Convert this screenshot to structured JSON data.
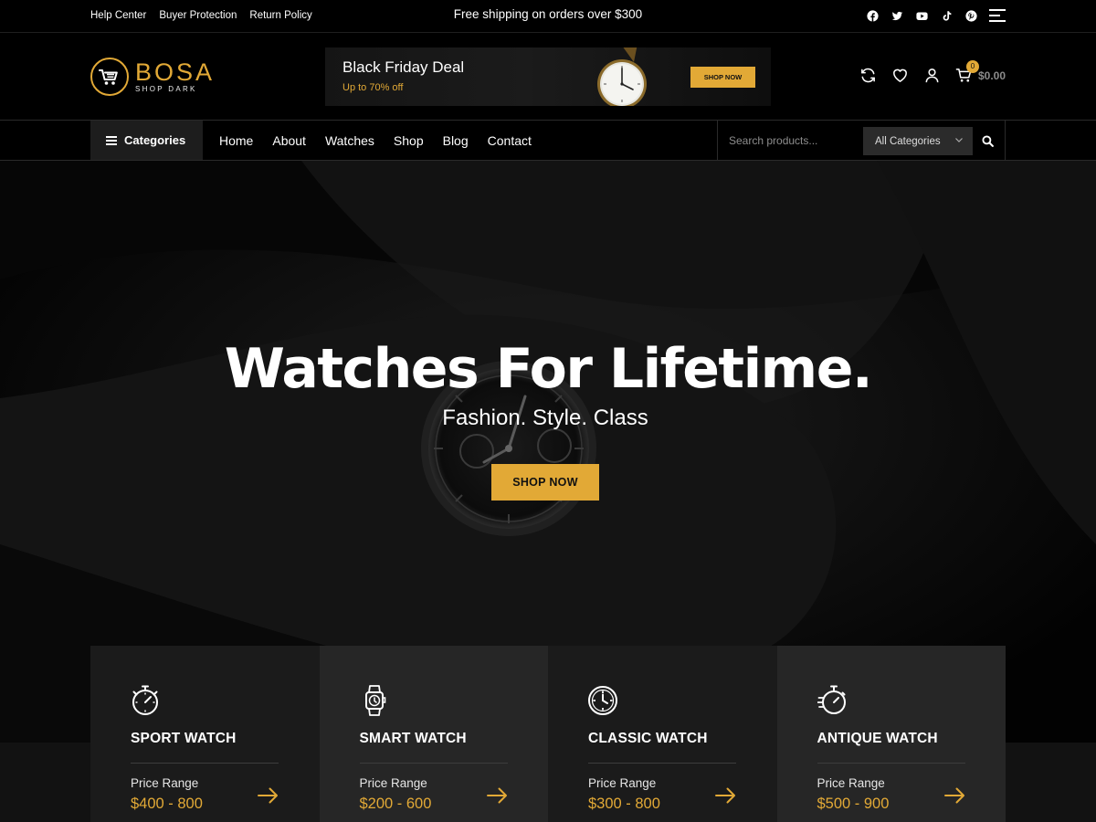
{
  "topbar": {
    "links": [
      "Help Center",
      "Buyer Protection",
      "Return Policy"
    ],
    "notice": "Free shipping on orders over $300",
    "social_icons": [
      "facebook-icon",
      "twitter-icon",
      "youtube-icon",
      "tiktok-icon",
      "pinterest-icon"
    ]
  },
  "header": {
    "logo_name": "BOSA",
    "logo_sub": "SHOP DARK",
    "banner": {
      "title": "Black Friday Deal",
      "subtitle": "Up to 70% off",
      "button": "SHOP NOW"
    },
    "cart_count": "0",
    "cart_total": "$0.00"
  },
  "nav": {
    "categories_label": "Categories",
    "menu": [
      "Home",
      "About",
      "Watches",
      "Shop",
      "Blog",
      "Contact"
    ],
    "search_placeholder": "Search products...",
    "category_select": "All Categories"
  },
  "hero": {
    "title": "Watches For Lifetime.",
    "subtitle": "Fashion. Style. Class",
    "button": "SHOP NOW"
  },
  "categories": [
    {
      "name": "SPORT WATCH",
      "price_label": "Price Range",
      "price": "$400 - 800",
      "icon": "stopwatch-icon"
    },
    {
      "name": "SMART WATCH",
      "price_label": "Price Range",
      "price": "$200 - 600",
      "icon": "smartwatch-icon"
    },
    {
      "name": "CLASSIC WATCH",
      "price_label": "Price Range",
      "price": "$300 - 800",
      "icon": "clock-icon"
    },
    {
      "name": "ANTIQUE WATCH",
      "price_label": "Price Range",
      "price": "$500 - 900",
      "icon": "fast-stopwatch-icon"
    }
  ],
  "colors": {
    "accent": "#e2a936",
    "background": "#000000",
    "card_dark": "#1b1b1b",
    "card_light": "#262626"
  }
}
